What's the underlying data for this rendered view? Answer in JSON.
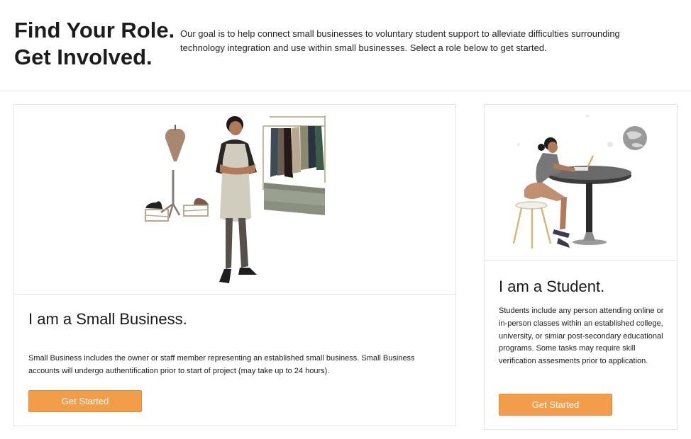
{
  "header": {
    "headline_line1": "Find Your Role.",
    "headline_line2": "Get Involved.",
    "intro": "Our goal is to help connect small businesses to voluntary student support to alleviate difficulties surrounding technology integration and use within small businesses. Select a role below to get started."
  },
  "business": {
    "title": "I am a Small Business.",
    "description": "Small Business includes the owner or staff member representing an established small business. Small Business accounts will undergo authentification prior to start of project (may take up to 24 hours).",
    "button": "Get Started"
  },
  "student": {
    "title": "I am a Student.",
    "description": "Students include any person attending online or in-person classes within an established college, university, or simiar post-secondary educational programs. Some tasks may require skill verification assesments prior to application.",
    "button": "Get Started"
  },
  "colors": {
    "button": "#f39c4a",
    "border": "#e3e3e3"
  }
}
